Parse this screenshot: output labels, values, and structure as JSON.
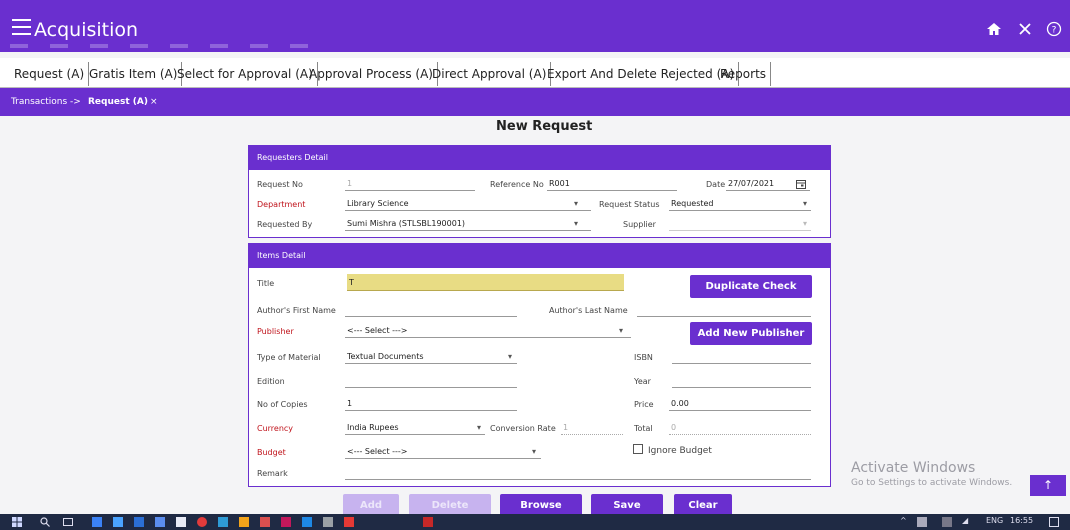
{
  "app": {
    "title": "Acquisition",
    "icons": [
      "menu-icon",
      "home-icon",
      "close-icon",
      "help-icon"
    ]
  },
  "menu_tabs": [
    "Request (A)",
    "Gratis Item (A)",
    "Select for Approval (A)",
    "Approval Process (A)",
    "Direct Approval (A)",
    "Export And Delete Rejected (A)",
    "Reports"
  ],
  "breadcrumb": {
    "root": "Transactions ->",
    "current": "Request (A)",
    "close": "×"
  },
  "page_title": "New Request",
  "requesters": {
    "header": "Requesters Detail",
    "request_no_label": "Request No",
    "request_no": "1",
    "reference_no_label": "Reference No",
    "reference_no": "R001",
    "date_label": "Date",
    "date": "27/07/2021",
    "department_label": "Department",
    "department": "Library Science",
    "request_status_label": "Request Status",
    "request_status": "Requested",
    "requested_by_label": "Requested By",
    "requested_by": "Sumi Mishra (STLSBL190001)",
    "supplier_label": "Supplier",
    "supplier": ""
  },
  "items": {
    "header": "Items Detail",
    "title_label": "Title",
    "title_value": "T",
    "duplicate_check": "Duplicate Check",
    "author_first_label": "Author's First Name",
    "author_first": "",
    "author_last_label": "Author's Last Name",
    "author_last": "",
    "publisher_label": "Publisher",
    "publisher": "<--- Select --->",
    "add_publisher": "Add New Publisher",
    "material_label": "Type of Material",
    "material": "Textual Documents",
    "isbn_label": "ISBN",
    "isbn": "",
    "edition_label": "Edition",
    "edition": "",
    "year_label": "Year",
    "year": "",
    "copies_label": "No of Copies",
    "copies": "1",
    "price_label": "Price",
    "price": "0.00",
    "currency_label": "Currency",
    "currency": "India Rupees",
    "conversion_label": "Conversion Rate",
    "conversion": "1",
    "total_label": "Total",
    "total": "0",
    "budget_label": "Budget",
    "budget": "<--- Select --->",
    "ignore_budget": "Ignore Budget",
    "remark_label": "Remark",
    "remark": ""
  },
  "actions": {
    "add": "Add",
    "delete": "Delete",
    "browse": "Browse",
    "save": "Save",
    "clear": "Clear"
  },
  "watermark": {
    "line1": "Activate Windows",
    "line2": "Go to Settings to activate Windows."
  },
  "scroll_up": "↑",
  "tray": {
    "lang": "ENG",
    "time": "16:55"
  },
  "colors": {
    "primary": "#6a2fcf",
    "required_label": "#c0141c",
    "title_highlight": "#e8dc84"
  }
}
